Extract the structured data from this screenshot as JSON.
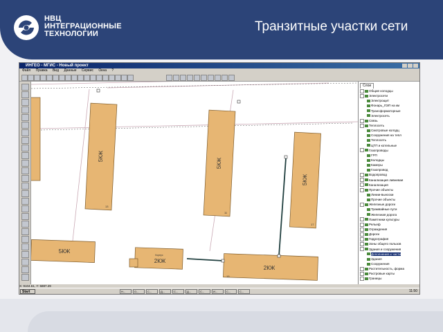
{
  "header": {
    "brand_line1": "НВЦ",
    "brand_line2": "ИНТЕГРАЦИОННЫЕ",
    "brand_line3": "ТЕХНОЛОГИИ",
    "title": "Транзитные участки сети",
    "bg_color": "#2c4478"
  },
  "app": {
    "window_title": "ИНГЕО - МГИС - Новый проект",
    "menu": [
      "Файл",
      "Правка",
      "Вид",
      "Данные",
      "Сервис",
      "Окна",
      "?"
    ],
    "scale_value": "773",
    "status_text": "X: 9104.61, Y: 5887.29",
    "panel_tab": "Слои"
  },
  "layers": [
    {
      "label": "Общие колодцы",
      "level": 0
    },
    {
      "label": "Электросети",
      "level": 0
    },
    {
      "label": "Электрощит",
      "level": 1
    },
    {
      "label": "Фонарь_ЛЭП на км",
      "level": 1
    },
    {
      "label": "Трансформаторные",
      "level": 1
    },
    {
      "label": "Электросеть",
      "level": 1
    },
    {
      "label": "Связь",
      "level": 0
    },
    {
      "label": "Теплосеть",
      "level": 0
    },
    {
      "label": "Смотровые колодц",
      "level": 1
    },
    {
      "label": "Сооружения на тепл",
      "level": 1
    },
    {
      "label": "Теплосеть",
      "level": 1
    },
    {
      "label": "ЦТП и котельные",
      "level": 1
    },
    {
      "label": "Газопроводы",
      "level": 0
    },
    {
      "label": "ГРП",
      "level": 1
    },
    {
      "label": "Колодцы",
      "level": 1
    },
    {
      "label": "Камеры",
      "level": 1
    },
    {
      "label": "Газопровод",
      "level": 1
    },
    {
      "label": "Водопровод",
      "level": 0
    },
    {
      "label": "Канализация ливневая",
      "level": 0
    },
    {
      "label": "Канализация",
      "level": 0
    },
    {
      "label": "Прочие объекты",
      "level": 0
    },
    {
      "label": "Линии-выноски",
      "level": 1
    },
    {
      "label": "Прочие объекты",
      "level": 1
    },
    {
      "label": "Железные дороги",
      "level": 0
    },
    {
      "label": "Трамвайные пути",
      "level": 1
    },
    {
      "label": "Железная дорога",
      "level": 1
    },
    {
      "label": "Памятники культуры",
      "level": 0
    },
    {
      "label": "Рельеф",
      "level": 0
    },
    {
      "label": "Ограждения",
      "level": 0
    },
    {
      "label": "Дороги",
      "level": 0
    },
    {
      "label": "Гидрография",
      "level": 0
    },
    {
      "label": "Зоны общего пользов",
      "level": 0
    },
    {
      "label": "Здания и сооружения",
      "level": 0
    },
    {
      "label": "Дополнения и части",
      "level": 1,
      "selected": true
    },
    {
      "label": "Здания",
      "level": 1
    },
    {
      "label": "Сооружения",
      "level": 1
    },
    {
      "label": "Растительность, форма",
      "level": 0
    },
    {
      "label": "Растровые карты",
      "level": 0
    },
    {
      "label": "Границы",
      "level": 0
    }
  ],
  "buildings": [
    {
      "label": "5КЖ",
      "num": "13"
    },
    {
      "label": "5КЖ",
      "num": "11"
    },
    {
      "label": "5КЖ",
      "num": "17"
    },
    {
      "label": "5КЖ",
      "num": ""
    },
    {
      "label": "5КЖ",
      "num": ""
    },
    {
      "label": "2КЖ",
      "num": "",
      "note": "Корпус"
    },
    {
      "label": "2КЖ",
      "num": "19"
    }
  ],
  "taskbar": {
    "start_label": "Start",
    "clock": "11:50",
    "buttons": [
      "Н...",
      "О...",
      "С...",
      "Д...",
      "С...",
      "Д...",
      "С...",
      "И...",
      "С...",
      "С..."
    ]
  },
  "colors": {
    "building_fill": "#e7b673",
    "building_stroke": "#7c5a2a",
    "network_line": "#1f3e3e",
    "selected_layer_bg": "#0a246a"
  }
}
